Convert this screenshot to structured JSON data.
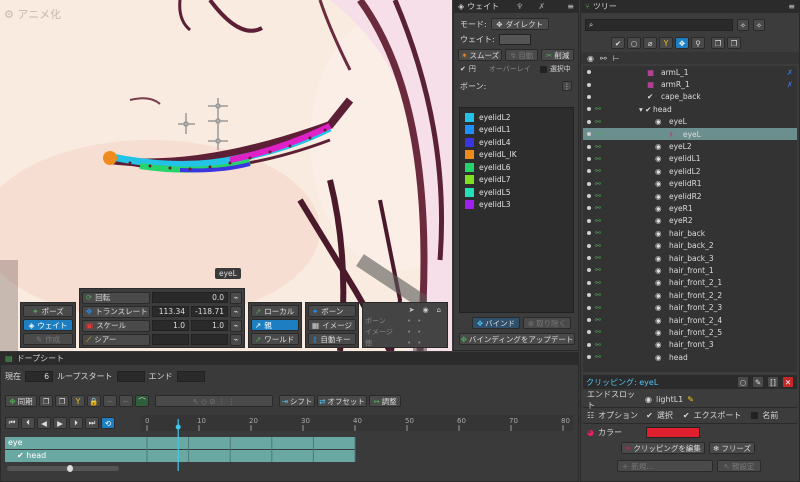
{
  "viewport": {
    "watermark": "アニメ化",
    "bone_tooltip": "eyeL"
  },
  "transform": {
    "mode_buttons": [
      {
        "label": "ポーズ",
        "active": false
      },
      {
        "label": "ウェイト",
        "active": true
      },
      {
        "label": "作成",
        "active": false
      }
    ],
    "rows": [
      {
        "label": "回転",
        "v1": "",
        "v2": "0.0"
      },
      {
        "label": "トランスレート",
        "v1": "113.34",
        "v2": "-118.71"
      },
      {
        "label": "スケール",
        "v1": "1.0",
        "v2": "1.0"
      },
      {
        "label": "シアー",
        "v1": "",
        "v2": ""
      }
    ],
    "axis_buttons": [
      {
        "label": "ローカル",
        "active": false
      },
      {
        "label": "親",
        "active": true
      },
      {
        "label": "ワールド",
        "active": false
      }
    ],
    "show_buttons": [
      {
        "label": "ボーン"
      },
      {
        "label": "イメージ"
      },
      {
        "label": "自動キー"
      }
    ],
    "vis_rows": [
      "ボーン",
      "イメージ",
      "他"
    ]
  },
  "weights": {
    "title": "ウェイト",
    "tab2_icon": "bone-icon",
    "mode_label": "モード:",
    "mode_value": "ダイレクト",
    "weight_label": "ウェイト:",
    "smooth_button": "スムーズ",
    "auto_button": "自動",
    "prune_button": "削減",
    "circle_label": "円",
    "overlay_label": "オーバーレイ",
    "selected_only_label": "選択中",
    "bones_label": "ボーン:",
    "bones": [
      {
        "name": "eyelidL2",
        "color": "#22c3e6"
      },
      {
        "name": "eyelidL1",
        "color": "#1e90ff"
      },
      {
        "name": "eyelidL4",
        "color": "#3b35e0"
      },
      {
        "name": "eyelidL_IK",
        "color": "#f08a1c"
      },
      {
        "name": "eyelidL6",
        "color": "#27d46b"
      },
      {
        "name": "eyelidL7",
        "color": "#7ee024"
      },
      {
        "name": "eyelidL5",
        "color": "#22e0b8"
      },
      {
        "name": "eyelidL3",
        "color": "#a020f0"
      }
    ],
    "bind_button": "バインド",
    "remove_button": "取り除く",
    "update_binding_button": "バインディングをアップデート"
  },
  "tree": {
    "title": "ツリー",
    "rows": [
      {
        "label": "armL_1",
        "indent": 78,
        "kind": "bone-pink",
        "right_icon": true
      },
      {
        "label": "armR_1",
        "indent": 78,
        "kind": "bone-pink",
        "right_icon": true
      },
      {
        "label": "cape_back",
        "indent": 78,
        "kind": "bone-check"
      },
      {
        "label": "head",
        "indent": 70,
        "kind": "bone-check",
        "expanded": true
      },
      {
        "label": "eyeL",
        "indent": 86,
        "kind": "slot"
      },
      {
        "label": "eyeL",
        "indent": 100,
        "kind": "attachment",
        "selected": true
      },
      {
        "label": "eyeL2",
        "indent": 86,
        "kind": "slot"
      },
      {
        "label": "eyelidL1",
        "indent": 86,
        "kind": "slot"
      },
      {
        "label": "eyelidL2",
        "indent": 86,
        "kind": "slot"
      },
      {
        "label": "eyelidR1",
        "indent": 86,
        "kind": "slot"
      },
      {
        "label": "eyelidR2",
        "indent": 86,
        "kind": "slot"
      },
      {
        "label": "eyeR1",
        "indent": 86,
        "kind": "slot"
      },
      {
        "label": "eyeR2",
        "indent": 86,
        "kind": "slot"
      },
      {
        "label": "hair_back",
        "indent": 86,
        "kind": "slot"
      },
      {
        "label": "hair_back_2",
        "indent": 86,
        "kind": "slot"
      },
      {
        "label": "hair_back_3",
        "indent": 86,
        "kind": "slot"
      },
      {
        "label": "hair_front_1",
        "indent": 86,
        "kind": "slot"
      },
      {
        "label": "hair_front_2_1",
        "indent": 86,
        "kind": "slot"
      },
      {
        "label": "hair_front_2_2",
        "indent": 86,
        "kind": "slot"
      },
      {
        "label": "hair_front_2_3",
        "indent": 86,
        "kind": "slot"
      },
      {
        "label": "hair_front_2_4",
        "indent": 86,
        "kind": "slot"
      },
      {
        "label": "hair_front_2_5",
        "indent": 86,
        "kind": "slot"
      },
      {
        "label": "hair_front_3",
        "indent": 86,
        "kind": "slot"
      },
      {
        "label": "head",
        "indent": 86,
        "kind": "slot"
      }
    ],
    "clipping_label": "クリッピング: eyeL",
    "end_slot_label": "エンドスロット",
    "end_slot_value": "lightL1",
    "options_label": "オプション",
    "select_label": "選択",
    "export_label": "エクスポート",
    "name_label": "名前",
    "color_label": "カラー",
    "color_value": "#e0202e",
    "edit_clipping_button": "クリッピングを編集",
    "freeze_button": "フリーズ",
    "new_button": "新規...",
    "setup_button": "親設定"
  },
  "dopesheet": {
    "title": "ドープシート",
    "current_label": "現在",
    "current_value": "6",
    "loop_start_label": "ループスタート",
    "end_label": "エンド",
    "sync_label": "同期",
    "shift_label": "シフト",
    "offset_label": "オフセット",
    "adjust_label": "調整",
    "ruler": [
      "0",
      "10",
      "20",
      "30",
      "40",
      "50",
      "60",
      "70",
      "80"
    ],
    "tracks": [
      {
        "label": "eye"
      },
      {
        "label": "head"
      }
    ],
    "playhead_frame": 6,
    "key_end_frame": 40
  }
}
